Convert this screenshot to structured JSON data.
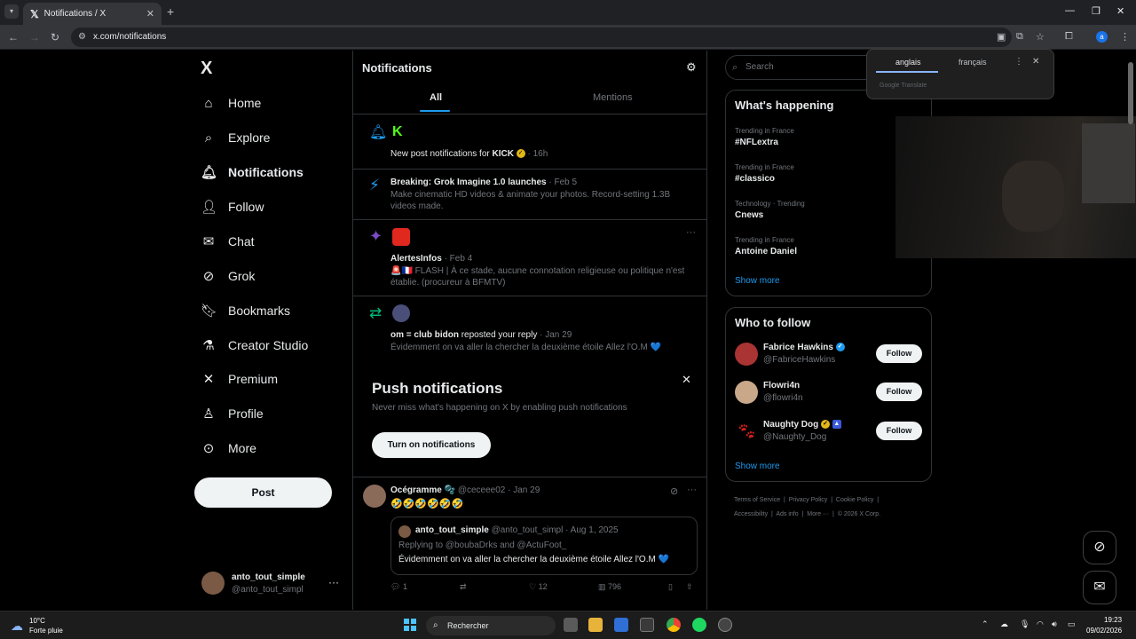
{
  "browser": {
    "tab_title": "Notifications / X",
    "tab_icon": "x-logo-icon",
    "url": "x.com/notifications",
    "translate": {
      "lang_source": "anglais",
      "lang_target": "français",
      "brand": "Google Translate"
    }
  },
  "sidebar": {
    "logo": "X",
    "items": [
      {
        "label": "Home",
        "icon": "home-icon"
      },
      {
        "label": "Explore",
        "icon": "search-icon"
      },
      {
        "label": "Notifications",
        "icon": "bell-icon",
        "active": true
      },
      {
        "label": "Follow",
        "icon": "person-add-icon"
      },
      {
        "label": "Chat",
        "icon": "mail-icon"
      },
      {
        "label": "Grok",
        "icon": "grok-icon"
      },
      {
        "label": "Bookmarks",
        "icon": "bookmark-icon"
      },
      {
        "label": "Creator Studio",
        "icon": "flask-icon"
      },
      {
        "label": "Premium",
        "icon": "x-premium-icon"
      },
      {
        "label": "Profile",
        "icon": "person-icon"
      },
      {
        "label": "More",
        "icon": "more-circle-icon"
      }
    ],
    "post_label": "Post",
    "account": {
      "name": "anto_tout_simple",
      "handle": "@anto_tout_simpl"
    }
  },
  "main": {
    "title": "Notifications",
    "tabs": [
      {
        "label": "All",
        "active": true
      },
      {
        "label": "Mentions",
        "active": false
      }
    ],
    "notifications": [
      {
        "text_pre": "New post notifications for ",
        "name": "KICK",
        "time": "· 16h"
      },
      {
        "title": "Breaking: Grok Imagine 1.0 launches",
        "time": "· Feb 5",
        "body": "Make cinematic HD videos & animate your photos. Record-setting 1.3B videos made."
      },
      {
        "name": "AlertesInfos",
        "time": "· Feb 4",
        "body": "🚨🇫🇷 FLASH | À ce stade, aucune connotation religieuse ou politique n'est établie. (procureur à BFMTV)"
      },
      {
        "name": "om = club bidon",
        "action": " reposted your reply",
        "time": "· Jan 29",
        "body": "Évidemment on va aller la chercher la deuxième étoile Allez l'O.M 💙"
      }
    ],
    "push": {
      "title": "Push notifications",
      "subtitle": "Never miss what's happening on X by enabling push notifications",
      "button": "Turn on notifications"
    },
    "tweet": {
      "name": "Océgramme 🫧",
      "handle": "@ceceee02",
      "time": "· Jan 29",
      "text": "🤣🤣🤣🤣🤣🤣",
      "quote": {
        "name": "anto_tout_simple",
        "handle": "@anto_tout_simpl",
        "time": "· Aug 1, 2025",
        "replying": "Replying to @boubaDrks and @ActuFoot_",
        "text": "Évidemment on va aller la chercher la deuxième étoile Allez l'O.M 💙"
      },
      "replies": "1",
      "likes": "12",
      "views": "796"
    }
  },
  "right": {
    "search_placeholder": "Search",
    "happening": {
      "title": "What's happening",
      "trends": [
        {
          "context": "Trending in France",
          "name": "#NFLextra"
        },
        {
          "context": "Trending in France",
          "name": "#classico"
        },
        {
          "context": "Technology · Trending",
          "name": "Cnews"
        },
        {
          "context": "Trending in France",
          "name": "Antoine Daniel"
        }
      ],
      "show_more": "Show more"
    },
    "who_to_follow": {
      "title": "Who to follow",
      "users": [
        {
          "name": "Fabrice Hawkins",
          "handle": "@FabriceHawkins",
          "button": "Follow"
        },
        {
          "name": "Flowri4n",
          "handle": "@flowri4n",
          "button": "Follow"
        },
        {
          "name": "Naughty Dog",
          "handle": "@Naughty_Dog",
          "button": "Follow"
        }
      ],
      "show_more": "Show more"
    },
    "footer": {
      "line1": [
        "Terms of Service",
        "Privacy Policy",
        "Cookie Policy"
      ],
      "line2": [
        "Accessibility",
        "Ads info",
        "More ···",
        "© 2026 X Corp."
      ]
    }
  },
  "taskbar": {
    "temp": "10°C",
    "weather": "Forte pluie",
    "search": "Rechercher",
    "time": "19:23",
    "date": "09/02/2026"
  },
  "colors": {
    "accent": "#1d9bf0",
    "background": "#000000",
    "border": "#2f3336"
  }
}
